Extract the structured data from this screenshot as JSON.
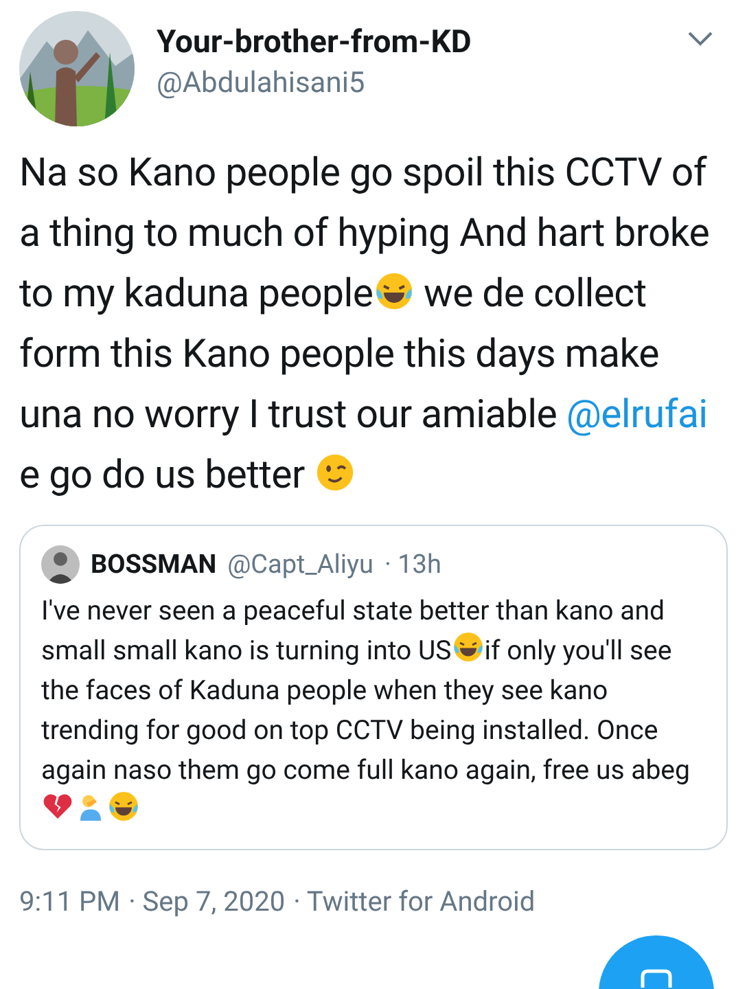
{
  "author": {
    "name": "Your-brother-from-KD",
    "handle": "@Abdulahisani5"
  },
  "body": [
    {
      "kind": "text",
      "text": "Na so Kano people go spoil this CCTV of a thing to much of hyping And hart broke to my kaduna people"
    },
    {
      "kind": "laugh"
    },
    {
      "kind": "text",
      "text": " we de collect form this Kano people this days make una no worry I trust our amiable "
    },
    {
      "kind": "mention",
      "text": "@elrufai"
    },
    {
      "kind": "text",
      "text": " e go do us better "
    },
    {
      "kind": "wink"
    }
  ],
  "quote": {
    "name": "BOSSMAN",
    "handle": "@Capt_Aliyu",
    "age": "· 13h",
    "body": [
      {
        "kind": "text",
        "text": "I've never seen a peaceful state better than kano and small small kano is turning into US"
      },
      {
        "kind": "laugh"
      },
      {
        "kind": "text",
        "text": "if only you'll see the faces of Kaduna people when they see kano trending for good on top CCTV being installed. Once again naso them go come full kano again, free us abeg"
      },
      {
        "kind": "heartbreak"
      },
      {
        "kind": "facepalm"
      },
      {
        "kind": "laugh"
      }
    ]
  },
  "meta": {
    "time": "9:11 PM",
    "date": "· Sep 7, 2020",
    "source": "· Twitter for Android"
  }
}
